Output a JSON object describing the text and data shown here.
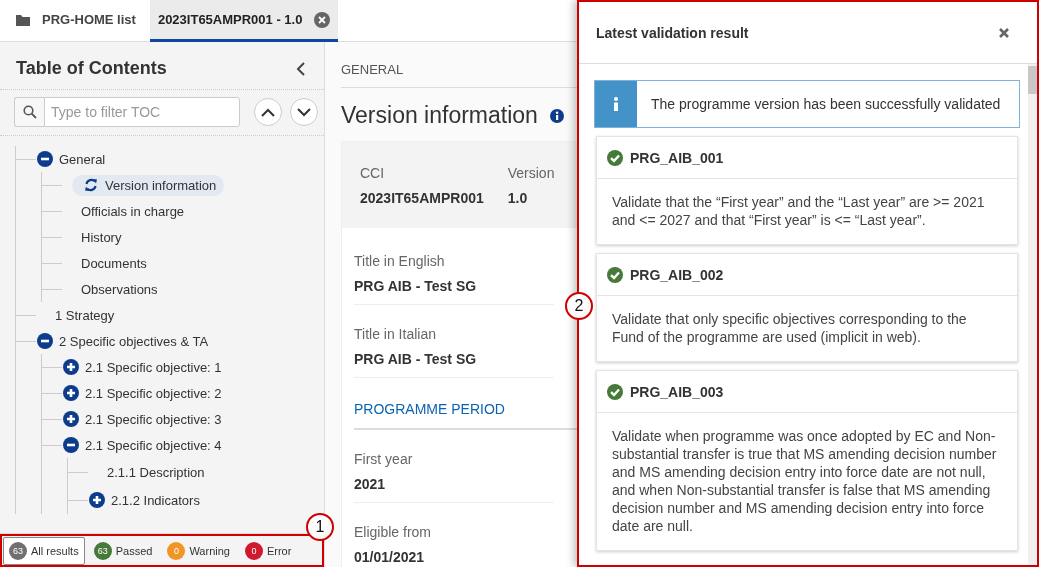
{
  "tabs": [
    {
      "label": "PRG-HOME list",
      "selected": false
    },
    {
      "label": "2023IT65AMPR001 - 1.0",
      "selected": true,
      "closable": true
    }
  ],
  "toc": {
    "title": "Table of Contents",
    "filter": {
      "placeholder": "Type to filter TOC"
    },
    "tree": [
      {
        "label": "General",
        "expanded": true,
        "children": [
          {
            "label": "Version information",
            "selected": true
          },
          {
            "label": "Officials in charge",
            "selected": false
          },
          {
            "label": "History",
            "selected": false
          },
          {
            "label": "Documents",
            "selected": false
          },
          {
            "label": "Observations",
            "selected": false
          }
        ]
      },
      {
        "label": "1 Strategy",
        "selected": false
      },
      {
        "label": "2 Specific objectives & TA",
        "expanded": true,
        "children": [
          {
            "label": "2.1 Specific objective: 1",
            "expanded": false
          },
          {
            "label": "2.1 Specific objective: 2",
            "expanded": false
          },
          {
            "label": "2.1 Specific objective: 3",
            "expanded": false
          },
          {
            "label": "2.1 Specific objective: 4",
            "expanded": true,
            "children": [
              {
                "label": "2.1.1 Description",
                "selected": false
              },
              {
                "label": "2.1.2 Indicators",
                "expanded": false
              }
            ]
          }
        ]
      }
    ]
  },
  "filter_bar": {
    "callout": "1",
    "filters": [
      {
        "count": "63",
        "label": "All results",
        "selected": true,
        "color": "#707070"
      },
      {
        "count": "63",
        "label": "Passed",
        "selected": false,
        "color": "#467a39"
      },
      {
        "count": "0",
        "label": "Warning",
        "selected": false,
        "color": "#f29527"
      },
      {
        "count": "0",
        "label": "Error",
        "selected": false,
        "color": "#d0182f"
      }
    ]
  },
  "content": {
    "breadcrumb": "GENERAL",
    "heading": "Version information",
    "summary": [
      {
        "label": "CCI",
        "value": "2023IT65AMPR001"
      },
      {
        "label": "Version",
        "value": "1.0"
      }
    ],
    "fields": [
      {
        "kind": "field",
        "label": "Title in English",
        "value": "PRG AIB - Test SG"
      },
      {
        "kind": "field",
        "label": "Title in Italian",
        "value": "PRG AIB - Test SG"
      },
      {
        "kind": "section",
        "label": "PROGRAMME PERIOD"
      },
      {
        "kind": "field",
        "label": "First year",
        "value": "2021"
      },
      {
        "kind": "field",
        "label": "Eligible from",
        "value": "01/01/2021"
      }
    ]
  },
  "validation_panel": {
    "callout": "2",
    "title": "Latest validation result",
    "message": "The programme version has been successfully validated",
    "results": [
      {
        "code": "PRG_AIB_001",
        "kind": "passed",
        "text": "Validate that the “First year” and the “Last year” are >= 2021 and <= 2027 and that “First year” is <= “Last year”."
      },
      {
        "code": "PRG_AIB_002",
        "kind": "passed",
        "text": "Validate that only specific objectives corresponding to the Fund of the programme are used (implicit in web)."
      },
      {
        "code": "PRG_AIB_003",
        "kind": "passed",
        "text": "Validate when programme was once adopted by EC and Non-substantial transfer is true that MS amending decision number and MS amending decision entry into force date are not null, and when Non-substantial transfer is false that MS amending decision number and MS amending decision entry into force date are null."
      }
    ]
  }
}
